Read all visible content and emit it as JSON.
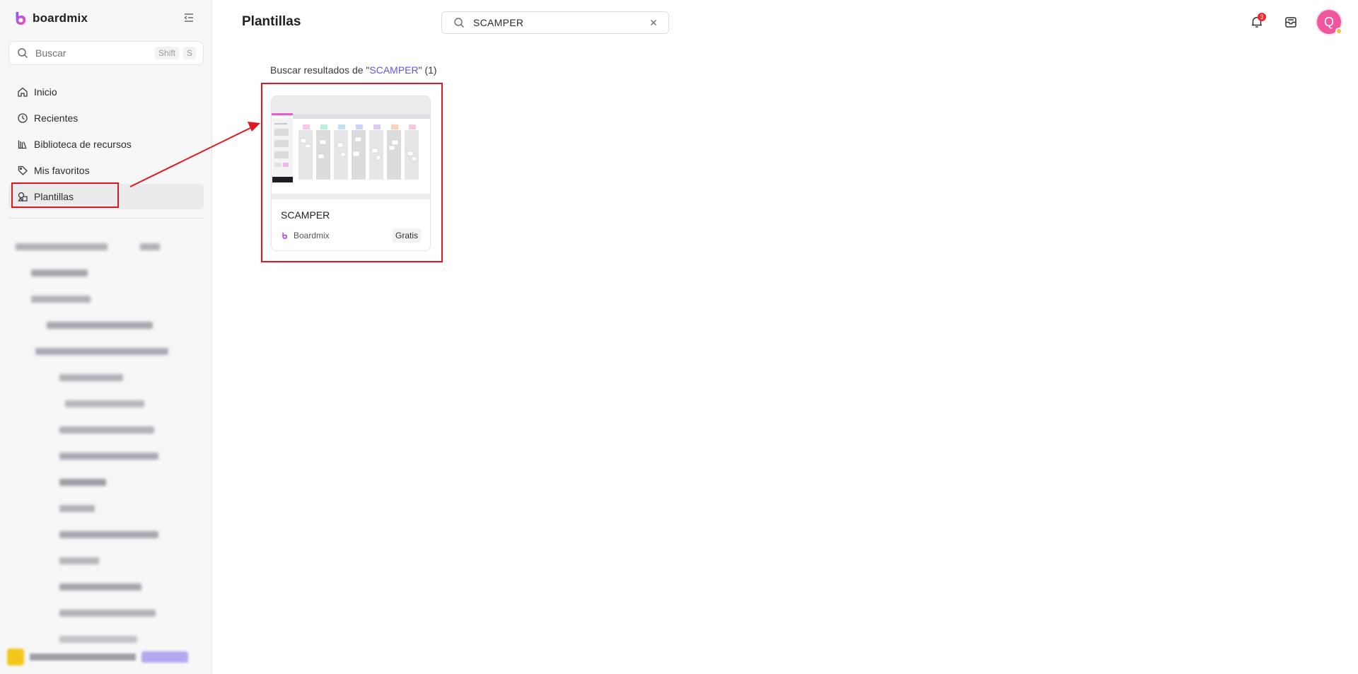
{
  "app": {
    "brand": "boardmix",
    "colors": {
      "accent": "#5b57e6",
      "highlight": "#e4161d",
      "avatar": "#f0569c"
    }
  },
  "sidebar": {
    "search": {
      "placeholder": "Buscar",
      "shortcut": [
        "Shift",
        "S"
      ]
    },
    "items": [
      {
        "label": "Inicio",
        "icon": "home-icon"
      },
      {
        "label": "Recientes",
        "icon": "clock-icon"
      },
      {
        "label": "Biblioteca de recursos",
        "icon": "library-icon"
      },
      {
        "label": "Mis favoritos",
        "icon": "tag-icon"
      },
      {
        "label": "Plantillas",
        "icon": "template-icon",
        "active": true
      }
    ]
  },
  "header": {
    "title": "Plantillas",
    "search_value": "SCAMPER",
    "notifications_count": "3",
    "avatar_initial": "Q"
  },
  "results": {
    "prefix": "Buscar resultados de \"",
    "query": "SCAMPER",
    "suffix": "\" (1)",
    "cards": [
      {
        "title": "SCAMPER",
        "author": "Boardmix",
        "price": "Gratis"
      }
    ]
  }
}
